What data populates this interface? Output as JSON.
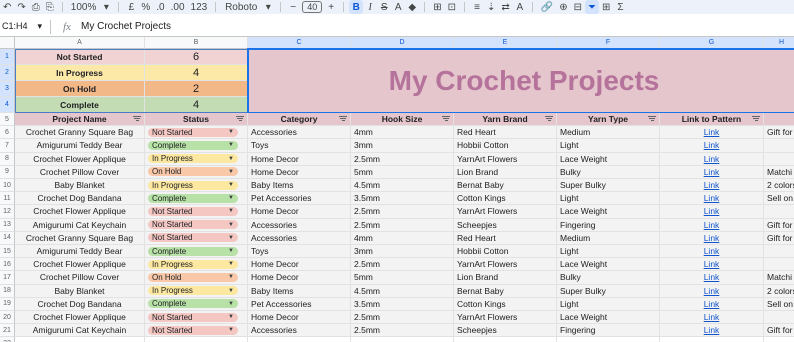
{
  "toolbar": {
    "items": [
      "↶",
      "↷",
      "⎙",
      "⎘",
      "100%",
      "▾",
      "£",
      "%",
      ".0",
      ".00",
      "123",
      "Roboto",
      "▾",
      "−",
      "40",
      "+",
      "B",
      "I",
      "S",
      "A",
      "◆",
      "⊞",
      "⊡",
      "≡",
      "⇣",
      "⇄",
      "A",
      "🔗",
      "⊕",
      "⊟",
      "⏷",
      "⊞",
      "Σ"
    ],
    "zoom": "100%",
    "font": "Roboto",
    "font_size": "40"
  },
  "formula_bar": {
    "name_box": "C1:H4",
    "fx": "fx",
    "formula": "My Crochet Projects"
  },
  "columns": [
    "A",
    "B",
    "C",
    "D",
    "E",
    "F",
    "G",
    "H"
  ],
  "rows": [
    "1",
    "2",
    "3",
    "4",
    "5",
    "6",
    "7",
    "8",
    "9",
    "10",
    "11",
    "12",
    "13",
    "14",
    "15",
    "16",
    "17",
    "18",
    "19",
    "20",
    "21",
    "22"
  ],
  "summary": [
    {
      "label": "Not Started",
      "value": "6",
      "color": "#f2d3d3"
    },
    {
      "label": "In Progress",
      "value": "4",
      "color": "#fce9a8"
    },
    {
      "label": "On Hold",
      "value": "2",
      "color": "#f3b888"
    },
    {
      "label": "Complete",
      "value": "4",
      "color": "#c3dcb4"
    }
  ],
  "title": "My Crochet Projects",
  "headers": [
    "Project Name",
    "Status",
    "Category",
    "Hook Size",
    "Yarn Brand",
    "Yarn Type",
    "Link to Pattern",
    ""
  ],
  "status_colors": {
    "Not Started": "#f4c7c3",
    "Complete": "#b7e1a6",
    "In Progress": "#fce8a0",
    "On Hold": "#f8c8a8"
  },
  "projects": [
    {
      "name": "Crochet Granny Square Bag",
      "status": "Not Started",
      "category": "Accessories",
      "hook": "4mm",
      "brand": "Red Heart",
      "type": "Medium",
      "link": "Link",
      "notes": "Gift for"
    },
    {
      "name": "Amigurumi Teddy Bear",
      "status": "Complete",
      "category": "Toys",
      "hook": "3mm",
      "brand": "Hobbii Cotton",
      "type": "Light",
      "link": "Link",
      "notes": ""
    },
    {
      "name": "Crochet Flower Applique",
      "status": "In Progress",
      "category": "Home Decor",
      "hook": "2.5mm",
      "brand": "YarnArt Flowers",
      "type": "Lace Weight",
      "link": "Link",
      "notes": ""
    },
    {
      "name": "Crochet Pillow Cover",
      "status": "On Hold",
      "category": "Home Decor",
      "hook": "5mm",
      "brand": "Lion Brand",
      "type": "Bulky",
      "link": "Link",
      "notes": "Matchi"
    },
    {
      "name": "Baby Blanket",
      "status": "In Progress",
      "category": "Baby Items",
      "hook": "4.5mm",
      "brand": "Bernat Baby",
      "type": "Super Bulky",
      "link": "Link",
      "notes": "2 colors"
    },
    {
      "name": "Crochet Dog Bandana",
      "status": "Complete",
      "category": "Pet Accessories",
      "hook": "3.5mm",
      "brand": "Cotton Kings",
      "type": "Light",
      "link": "Link",
      "notes": "Sell on"
    },
    {
      "name": "Crochet Flower Applique",
      "status": "Not Started",
      "category": "Home Decor",
      "hook": "2.5mm",
      "brand": "YarnArt Flowers",
      "type": "Lace Weight",
      "link": "Link",
      "notes": ""
    },
    {
      "name": "Amigurumi Cat Keychain",
      "status": "Not Started",
      "category": "Accessories",
      "hook": "2.5mm",
      "brand": "Scheepjes",
      "type": "Fingering",
      "link": "Link",
      "notes": "Gift for"
    },
    {
      "name": "Crochet Granny Square Bag",
      "status": "Not Started",
      "category": "Accessories",
      "hook": "4mm",
      "brand": "Red Heart",
      "type": "Medium",
      "link": "Link",
      "notes": "Gift for"
    },
    {
      "name": "Amigurumi Teddy Bear",
      "status": "Complete",
      "category": "Toys",
      "hook": "3mm",
      "brand": "Hobbii Cotton",
      "type": "Light",
      "link": "Link",
      "notes": ""
    },
    {
      "name": "Crochet Flower Applique",
      "status": "In Progress",
      "category": "Home Decor",
      "hook": "2.5mm",
      "brand": "YarnArt Flowers",
      "type": "Lace Weight",
      "link": "Link",
      "notes": ""
    },
    {
      "name": "Crochet Pillow Cover",
      "status": "On Hold",
      "category": "Home Decor",
      "hook": "5mm",
      "brand": "Lion Brand",
      "type": "Bulky",
      "link": "Link",
      "notes": "Matchi"
    },
    {
      "name": "Baby Blanket",
      "status": "In Progress",
      "category": "Baby Items",
      "hook": "4.5mm",
      "brand": "Bernat Baby",
      "type": "Super Bulky",
      "link": "Link",
      "notes": "2 colors"
    },
    {
      "name": "Crochet Dog Bandana",
      "status": "Complete",
      "category": "Pet Accessories",
      "hook": "3.5mm",
      "brand": "Cotton Kings",
      "type": "Light",
      "link": "Link",
      "notes": "Sell on"
    },
    {
      "name": "Crochet Flower Applique",
      "status": "Not Started",
      "category": "Home Decor",
      "hook": "2.5mm",
      "brand": "YarnArt Flowers",
      "type": "Lace Weight",
      "link": "Link",
      "notes": ""
    },
    {
      "name": "Amigurumi Cat Keychain",
      "status": "Not Started",
      "category": "Accessories",
      "hook": "2.5mm",
      "brand": "Scheepjes",
      "type": "Fingering",
      "link": "Link",
      "notes": "Gift for"
    }
  ]
}
